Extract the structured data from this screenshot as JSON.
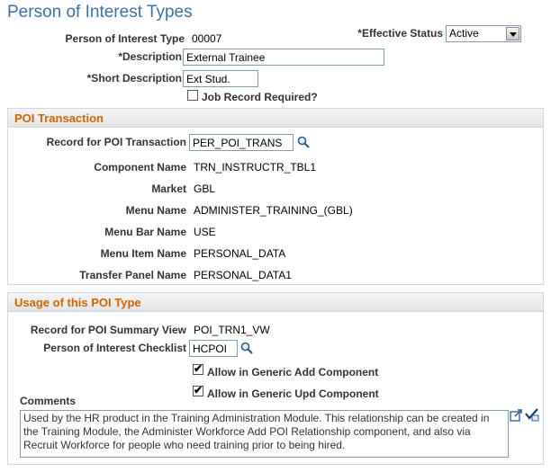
{
  "page": {
    "title": "Person of Interest Types"
  },
  "header": {
    "poi_type_label": "Person of Interest Type",
    "poi_type_value": "00007",
    "effective_status_label": "*Effective Status",
    "effective_status_value": "Active",
    "description_label": "*Description",
    "description_value": "External Trainee",
    "short_description_label": "*Short Description",
    "short_description_value": "Ext Stud.",
    "job_record_label": "Job Record Required?"
  },
  "poi_transaction": {
    "title": "POI Transaction",
    "record_label": "Record for POI Transaction",
    "record_value": "PER_POI_TRANS",
    "component_label": "Component Name",
    "component_value": "TRN_INSTRUCTR_TBL1",
    "market_label": "Market",
    "market_value": "GBL",
    "menu_name_label": "Menu Name",
    "menu_name_value": "ADMINISTER_TRAINING_(GBL)",
    "menu_bar_label": "Menu Bar Name",
    "menu_bar_value": "USE",
    "menu_item_label": "Menu Item Name",
    "menu_item_value": "PERSONAL_DATA",
    "transfer_panel_label": "Transfer Panel Name",
    "transfer_panel_value": "PERSONAL_DATA1"
  },
  "usage": {
    "title": "Usage of this POI Type",
    "summary_view_label": "Record for POI Summary View",
    "summary_view_value": "POI_TRN1_VW",
    "checklist_label": "Person of Interest Checklist",
    "checklist_value": "HCPOI",
    "allow_add_label": "Allow in Generic Add Component",
    "allow_upd_label": "Allow in Generic Upd Component",
    "comments_label": "Comments",
    "comments_value": "Used by the HR product in the Training Administration Module. This relationship can be created in the Training Module, the Administer Workforce Add POI Relationship component, and also via Recruit Workforce for people who need training prior to being hired."
  }
}
